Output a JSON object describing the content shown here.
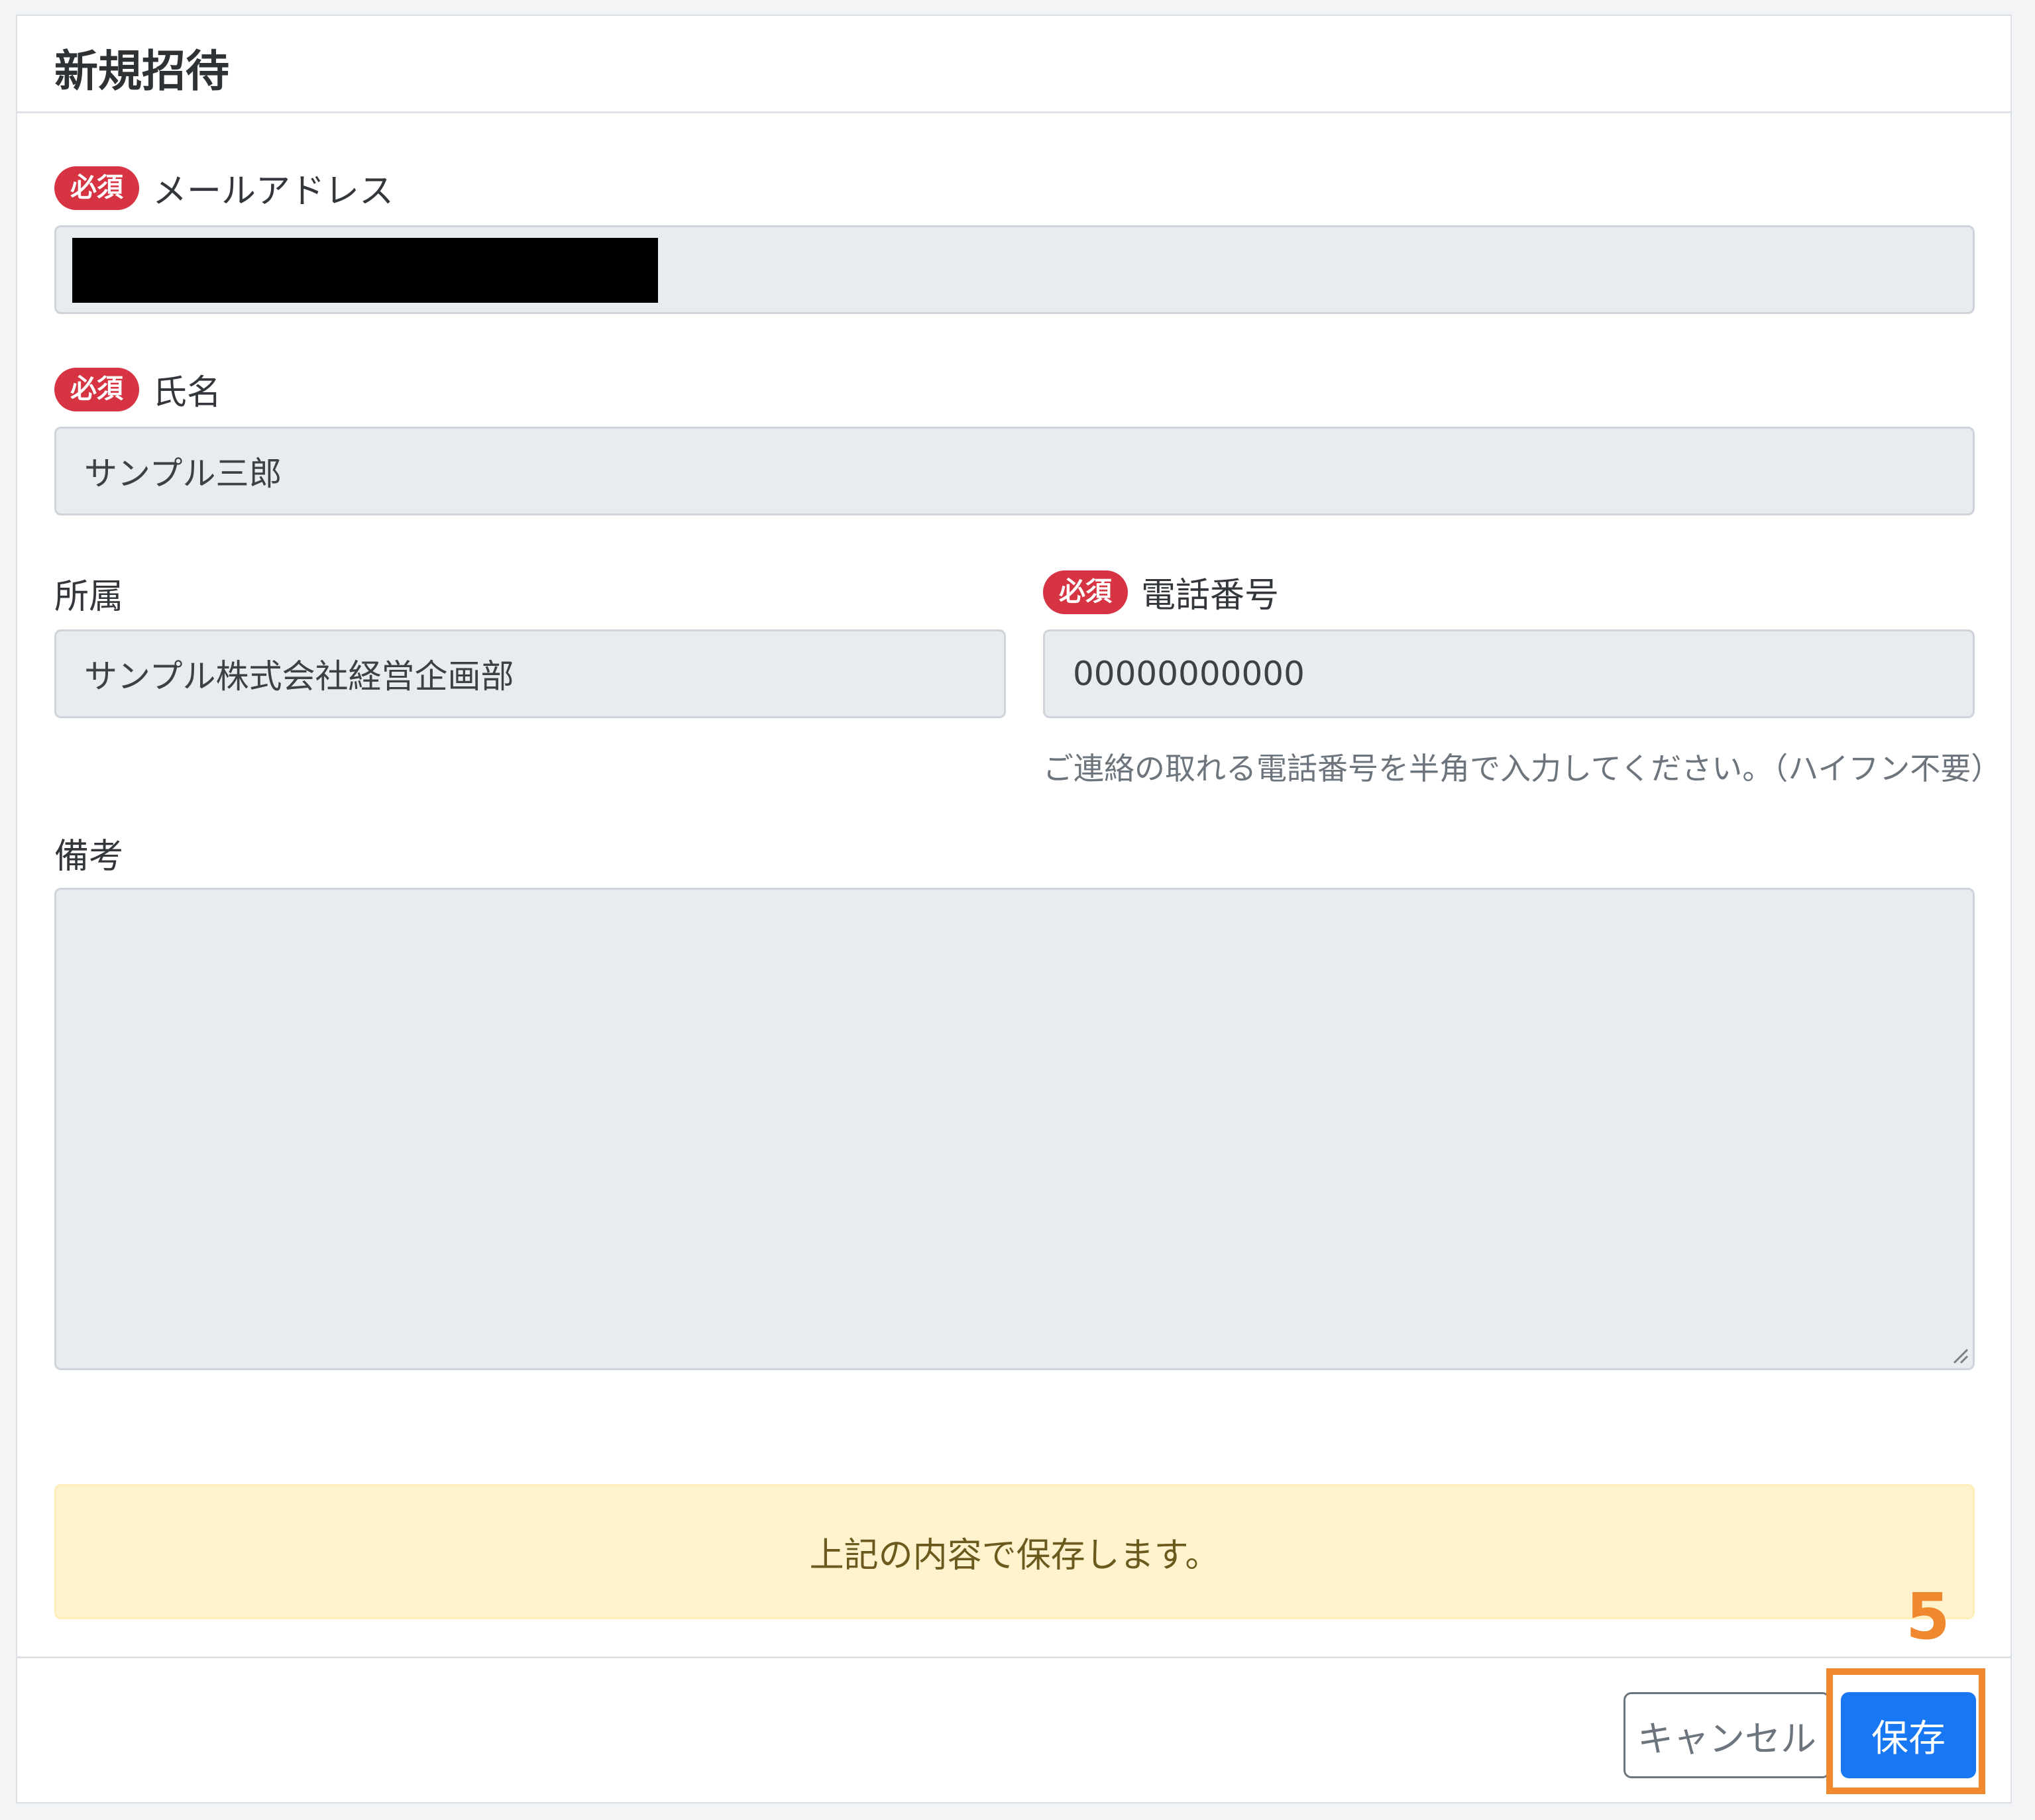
{
  "modal": {
    "title": "新規招待"
  },
  "badges": {
    "required": "必須"
  },
  "form": {
    "email": {
      "label": "メールアドレス",
      "value": ""
    },
    "name": {
      "label": "氏名",
      "value": "サンプル三郎"
    },
    "affiliation": {
      "label": "所属",
      "value": "サンプル株式会社経営企画部"
    },
    "phone": {
      "label": "電話番号",
      "value": "00000000000",
      "hint": "ご連絡の取れる電話番号を半角で入力してください。（ハイフン不要）"
    },
    "remarks": {
      "label": "備考",
      "value": ""
    }
  },
  "alert": {
    "message": "上記の内容で保存します。"
  },
  "footer": {
    "cancel_label": "キャンセル",
    "save_label": "保存"
  },
  "annotation": {
    "step_number": "5",
    "color": "#f0882f"
  },
  "colors": {
    "required_badge": "#d63343",
    "primary_button": "#1877f2",
    "alert_background": "#fff3cd",
    "field_background": "#e9ecef"
  }
}
